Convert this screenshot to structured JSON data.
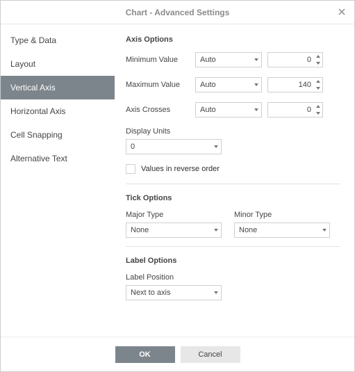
{
  "dialog": {
    "title": "Chart - Advanced Settings"
  },
  "sidebar": {
    "items": [
      {
        "label": "Type & Data",
        "active": false
      },
      {
        "label": "Layout",
        "active": false
      },
      {
        "label": "Vertical Axis",
        "active": true
      },
      {
        "label": "Horizontal Axis",
        "active": false
      },
      {
        "label": "Cell Snapping",
        "active": false
      },
      {
        "label": "Alternative Text",
        "active": false
      }
    ]
  },
  "axis_options": {
    "heading": "Axis Options",
    "min_label": "Minimum Value",
    "min_mode": "Auto",
    "min_value": "0",
    "max_label": "Maximum Value",
    "max_mode": "Auto",
    "max_value": "140",
    "crosses_label": "Axis Crosses",
    "crosses_mode": "Auto",
    "crosses_value": "0",
    "display_units_label": "Display Units",
    "display_units_value": "0",
    "reverse_label": "Values in reverse order"
  },
  "tick_options": {
    "heading": "Tick Options",
    "major_label": "Major Type",
    "major_value": "None",
    "minor_label": "Minor Type",
    "minor_value": "None"
  },
  "label_options": {
    "heading": "Label Options",
    "position_label": "Label Position",
    "position_value": "Next to axis"
  },
  "footer": {
    "ok": "OK",
    "cancel": "Cancel"
  }
}
